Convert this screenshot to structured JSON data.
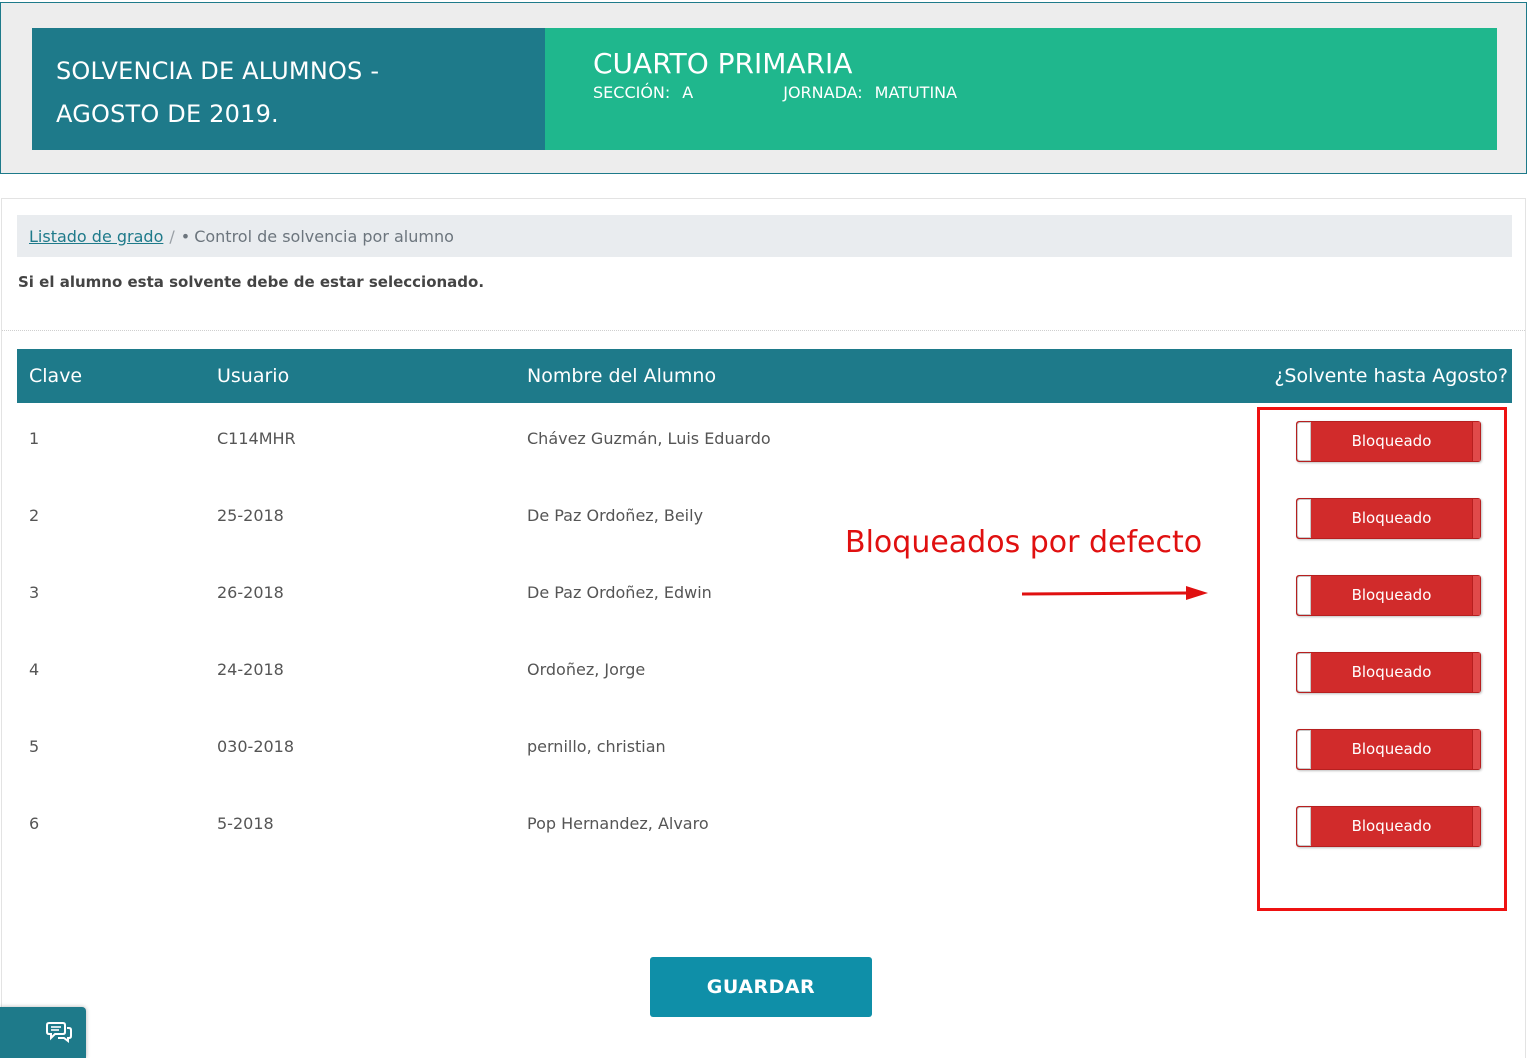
{
  "header": {
    "title_line1": "SOLVENCIA DE ALUMNOS -",
    "title_line2": "AGOSTO DE 2019.",
    "grade": "CUARTO PRIMARIA",
    "seccion_label": "SECCIÓN:",
    "seccion_value": "A",
    "jornada_label": "JORNADA:",
    "jornada_value": "MATUTINA"
  },
  "breadcrumb": {
    "link": "Listado de grado",
    "separator": "/",
    "bullet": "•",
    "current": "Control de solvencia por alumno"
  },
  "instruction": "Si el alumno esta solvente debe de estar seleccionado.",
  "table": {
    "columns": {
      "clave": "Clave",
      "usuario": "Usuario",
      "nombre": "Nombre del Alumno",
      "solvente": "¿Solvente hasta Agosto?"
    },
    "rows": [
      {
        "clave": "1",
        "usuario": "C114MHR",
        "nombre": "Chávez Guzmán, Luis Eduardo",
        "toggle": "Bloqueado"
      },
      {
        "clave": "2",
        "usuario": "25-2018",
        "nombre": "De Paz Ordoñez, Beily",
        "toggle": "Bloqueado"
      },
      {
        "clave": "3",
        "usuario": "26-2018",
        "nombre": "De Paz Ordoñez, Edwin",
        "toggle": "Bloqueado"
      },
      {
        "clave": "4",
        "usuario": "24-2018",
        "nombre": "Ordoñez, Jorge",
        "toggle": "Bloqueado"
      },
      {
        "clave": "5",
        "usuario": "030-2018",
        "nombre": "pernillo, christian",
        "toggle": "Bloqueado"
      },
      {
        "clave": "6",
        "usuario": "5-2018",
        "nombre": "Pop Hernandez, Alvaro",
        "toggle": "Bloqueado"
      }
    ]
  },
  "annotation": {
    "text": "Bloqueados por defecto",
    "color": "#e01010"
  },
  "save_button": "GUARDAR",
  "colors": {
    "primary": "#1e7a8a",
    "accent": "#1fb78d",
    "toggle_off": "#d12b2b",
    "button": "#0f8fa8"
  },
  "icons": {
    "chat": "chat-bubbles-icon"
  }
}
